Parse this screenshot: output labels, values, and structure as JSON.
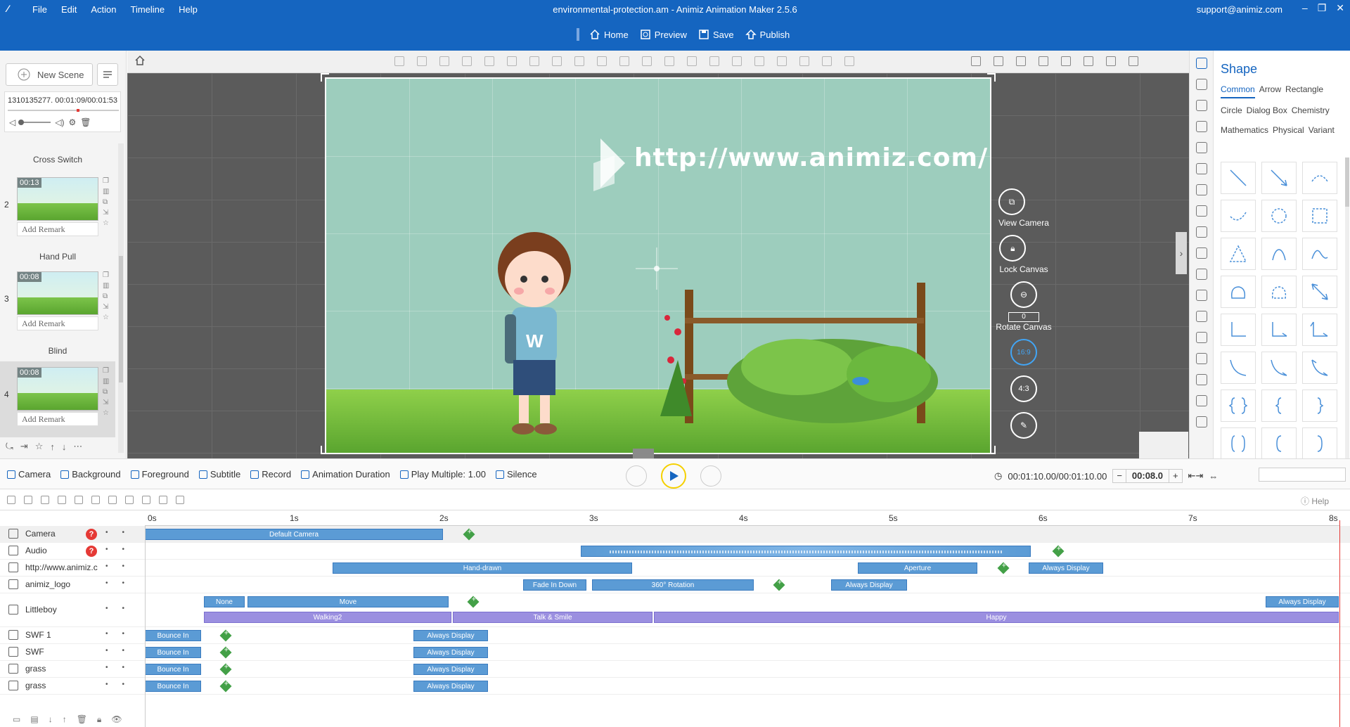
{
  "app": {
    "title": "environmental-protection.am - Animiz Animation Maker 2.5.6",
    "support": "support@animiz.com",
    "menu": [
      "File",
      "Edit",
      "Action",
      "Timeline",
      "Help"
    ],
    "main_buttons": {
      "home": "Home",
      "preview": "Preview",
      "save": "Save",
      "publish": "Publish"
    }
  },
  "left": {
    "new_scene": "New Scene",
    "audio": {
      "name": "1310135277.",
      "time": "00:01:09/00:01:53"
    },
    "scenes": [
      {
        "label_above": "Cross Switch"
      },
      {
        "num": "2",
        "duration": "00:13",
        "remark": "Add Remark",
        "label": "Hand Pull"
      },
      {
        "num": "3",
        "duration": "00:08",
        "remark": "Add Remark",
        "label": "Blind"
      },
      {
        "num": "4",
        "duration": "00:08",
        "remark": "Add Remark",
        "label": ""
      }
    ]
  },
  "canvas": {
    "url_text": "http://www.animiz.com/",
    "view_camera": "View Camera",
    "lock_canvas": "Lock Canvas",
    "rotate_value": "0",
    "rotate_canvas": "Rotate Canvas",
    "ratio_169": "16:9",
    "ratio_43": "4:3",
    "boy_letter": "W"
  },
  "right": {
    "title": "Shape",
    "tabs": [
      "Common",
      "Arrow",
      "Rectangle",
      "Circle",
      "Dialog Box",
      "Chemistry",
      "Mathematics",
      "Physical",
      "Variant"
    ],
    "selected_tab": "Common"
  },
  "playbar": {
    "camera": "Camera",
    "background": "Background",
    "foreground": "Foreground",
    "subtitle": "Subtitle",
    "record": "Record",
    "animation_duration": "Animation Duration",
    "play_multiple": "Play Multiple: 1.00",
    "silence": "Silence",
    "time": "00:01:10.00/00:01:10.00",
    "step": "00:08.0",
    "minus": "−",
    "plus": "+"
  },
  "timeline": {
    "help": "Help",
    "ticks": [
      "0s",
      "1s",
      "2s",
      "3s",
      "4s",
      "5s",
      "6s",
      "7s",
      "8s"
    ],
    "rows": [
      {
        "name": "Camera",
        "q": "?",
        "blocks": [
          {
            "label": "Default Camera"
          }
        ]
      },
      {
        "name": "Audio",
        "q": "?",
        "blocks": [
          {
            "label": ""
          }
        ]
      },
      {
        "name": "http://www.animiz.c",
        "blocks": [
          {
            "label": "Hand-drawn"
          },
          {
            "label": "Aperture"
          },
          {
            "label": "Always Display"
          }
        ]
      },
      {
        "name": "animiz_logo",
        "blocks": [
          {
            "label": "Fade In Down"
          },
          {
            "label": "360° Rotation"
          },
          {
            "label": "Always Display"
          }
        ]
      },
      {
        "name": "Littleboy",
        "blocks": [
          {
            "label": "None"
          },
          {
            "label": "Move"
          },
          {
            "label": "Always Display"
          },
          {
            "label": "Walking2"
          },
          {
            "label": "Talk & Smile"
          },
          {
            "label": "Happy"
          }
        ]
      },
      {
        "name": "SWF 1",
        "blocks": [
          {
            "label": "Bounce In"
          },
          {
            "label": "Always Display"
          }
        ]
      },
      {
        "name": "SWF",
        "blocks": [
          {
            "label": "Bounce In"
          },
          {
            "label": "Always Display"
          }
        ]
      },
      {
        "name": "grass",
        "blocks": [
          {
            "label": "Bounce In"
          },
          {
            "label": "Always Display"
          }
        ]
      },
      {
        "name": "grass",
        "blocks": [
          {
            "label": "Bounce In"
          },
          {
            "label": "Always Display"
          }
        ]
      }
    ]
  },
  "colors": {
    "brand": "#1565c0",
    "keyframe": "#43a047",
    "block": "#5b9bd5",
    "action": "#9b8fe0",
    "playhead": "#e53935"
  }
}
